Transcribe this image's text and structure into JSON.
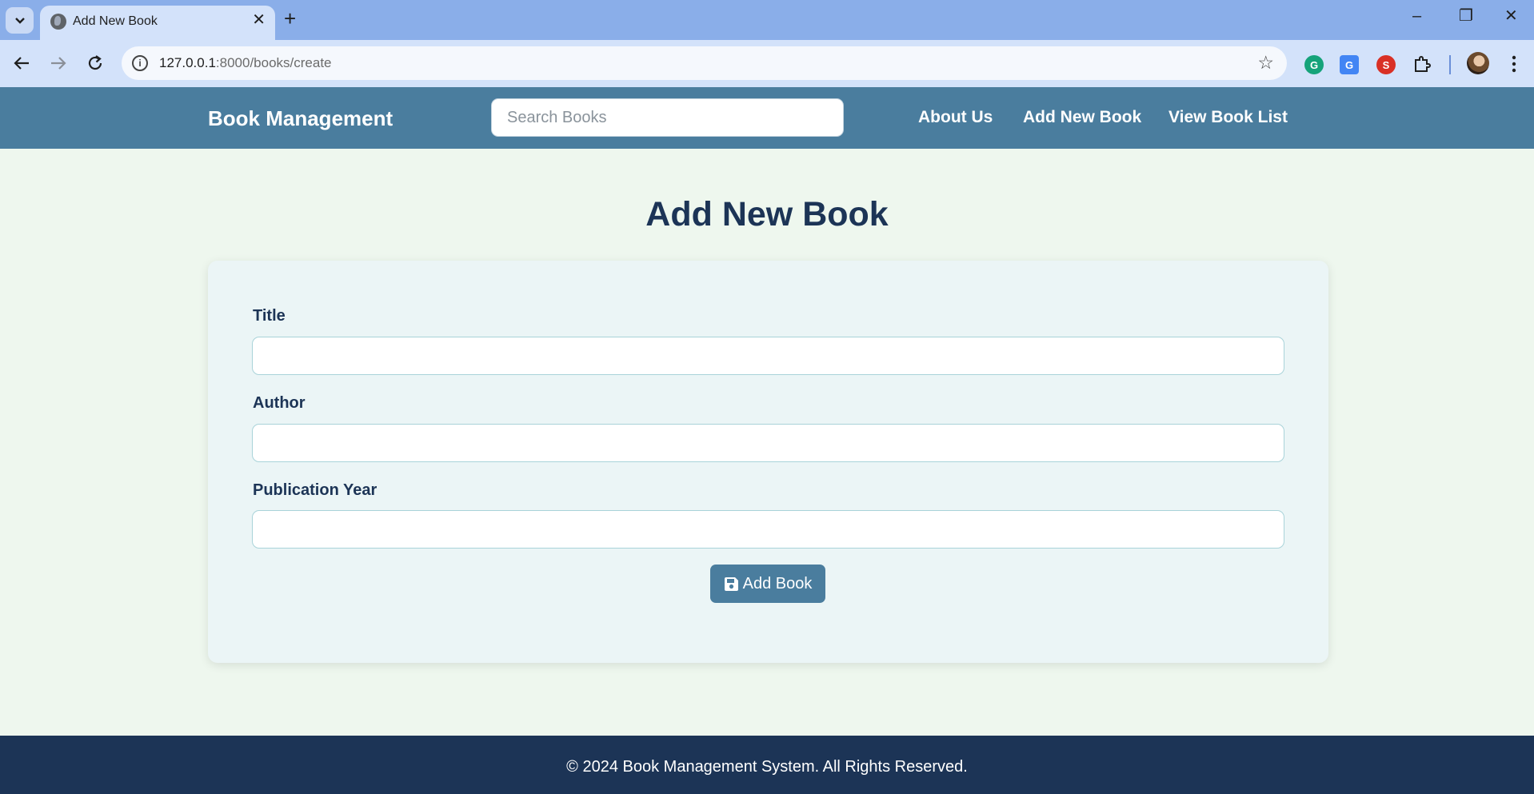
{
  "browser": {
    "tab_title": "Add New Book",
    "tab_close": "✕",
    "new_tab": "+",
    "url_host": "127.0.0.1",
    "url_rest": ":8000/books/create",
    "window_controls": [
      "–",
      "❐",
      "✕"
    ],
    "extensions": [
      {
        "name": "grammarly-icon",
        "glyph": "G",
        "color": "#15a37a"
      },
      {
        "name": "google-translate-icon",
        "glyph": "G",
        "color": "#4285f4"
      },
      {
        "name": "seo-extension-icon",
        "glyph": "S",
        "color": "#d93025"
      }
    ]
  },
  "header": {
    "brand": "Book Management",
    "search_placeholder": "Search Books",
    "nav": [
      "About Us",
      "Add New Book",
      "View Book List"
    ]
  },
  "main": {
    "title": "Add New Book",
    "fields": [
      {
        "label": "Title",
        "value": ""
      },
      {
        "label": "Author",
        "value": ""
      },
      {
        "label": "Publication Year",
        "value": ""
      }
    ],
    "submit_label": "Add Book"
  },
  "footer": {
    "text": "© 2024 Book Management System. All Rights Reserved."
  },
  "colors": {
    "header_bg": "#4a7d9e",
    "page_bg": "#eef7ee",
    "card_bg": "#ebf5f6",
    "heading": "#1c3456",
    "footer_bg": "#1c3456",
    "button_bg": "#4a7d9e"
  }
}
